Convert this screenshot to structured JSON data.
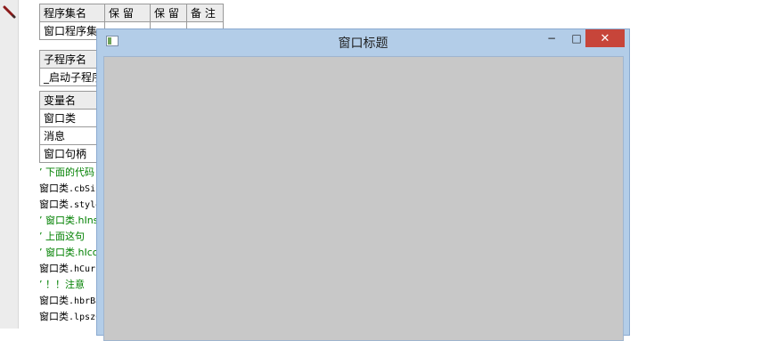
{
  "table1": {
    "headers": [
      "程序集名",
      "保 留",
      "保 留",
      "备 注"
    ],
    "row": [
      "窗口程序集",
      "",
      "",
      ""
    ]
  },
  "table2": {
    "headers": [
      "子程序名"
    ],
    "row": [
      "_启动子程序"
    ]
  },
  "table3": {
    "headers": [
      "变量名"
    ],
    "rows": [
      "窗口类",
      "消息",
      "窗口句柄"
    ]
  },
  "code_lines": [
    {
      "type": "comment",
      "prefix": "’ ",
      "text": "下面的代码"
    },
    {
      "type": "code",
      "prefix": "窗口类",
      "text": ".cbSize"
    },
    {
      "type": "code",
      "prefix": "窗口类",
      "text": ".style"
    },
    {
      "type": "comment",
      "prefix": "’ ",
      "text": "窗口类.hInstance"
    },
    {
      "type": "comment",
      "prefix": "’ ",
      "text": "上面这句"
    },
    {
      "type": "comment",
      "prefix": "’ ",
      "text": "窗口类.hIcon"
    },
    {
      "type": "code",
      "prefix": "窗口类",
      "text": ".hCursor"
    },
    {
      "type": "comment",
      "prefix": "’ ",
      "text": "！！注意"
    },
    {
      "type": "code",
      "prefix": "窗口类",
      "text": ".hbrBackground"
    },
    {
      "type": "code",
      "prefix": "窗口类",
      "text": ".lpszClassName"
    }
  ],
  "window": {
    "title": "窗口标题",
    "min_label": "−",
    "max_label": "□",
    "close_label": "✕"
  },
  "icons": {
    "gutter": "pencil-icon",
    "window": "app-window-icon"
  }
}
